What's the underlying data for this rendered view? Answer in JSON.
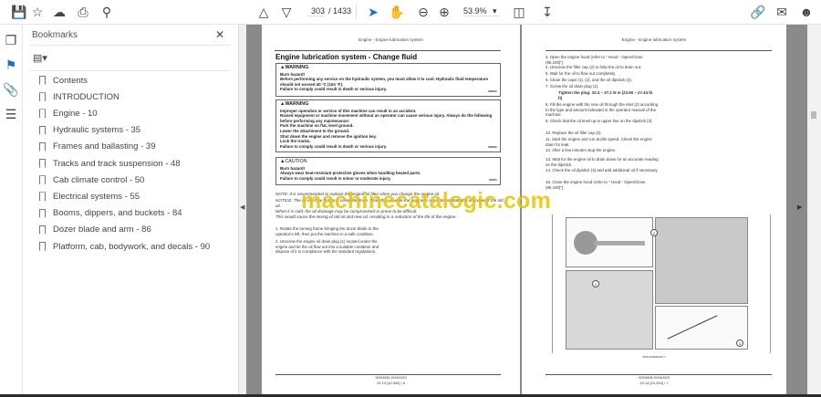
{
  "toolbar": {
    "page_current": "303",
    "page_total": "/ 1433",
    "zoom": "53.9%"
  },
  "bookmarks": {
    "title": "Bookmarks",
    "items": [
      "Contents",
      "INTRODUCTION",
      "Engine - 10",
      "Hydraulic systems - 35",
      "Frames and ballasting - 39",
      "Tracks and track suspension - 48",
      "Cab climate control - 50",
      "Electrical systems - 55",
      "Booms, dippers, and buckets - 84",
      "Dozer blade and arm - 86",
      "Platform, cab, bodywork, and decals - 90"
    ]
  },
  "left_page": {
    "header": "Engine - Engine lubrication system",
    "title": "Engine lubrication system - Change fluid",
    "warning1": {
      "label": "WARNING",
      "lines": [
        "Burn hazard!",
        "Before performing any service on the hydraulic system, you must allow it to cool. Hydraulic fluid temperature should not exceed 40 °C (104 °F).",
        "Failure to comply could result in death or serious injury."
      ],
      "code": "W0001A"
    },
    "warning2": {
      "label": "WARNING",
      "lines": [
        "Improper operation or service of this machine can result in an accident.",
        "Raised equipment or machine movement without an operator can cause serious injury. Always do the following before performing any maintenance:",
        "Park the machine on flat, level ground.",
        "Lower the attachment to the ground.",
        "Shut down the engine and remove the ignition key.",
        "Lock the tracks.",
        "Failure to comply could result in death or serious injury."
      ],
      "code": "W0002A"
    },
    "caution": {
      "label": "CAUTION",
      "lines": [
        "Burn hazard!",
        "Always wear heat-resistant protective gloves when handling heated parts.",
        "Failure to comply could result in minor or moderate injury."
      ],
      "code": "C0007A"
    },
    "notes": [
      "NOTE: It is recommended to replace the engine oil filter when you change the engine oil.",
      "NOTICE: The oil must be hot for a complete drain. Drain the oil while the engine is warm to facilitate the drainage of the old oil.",
      "When it is cold, the oil drainage may be compromised or prove to be difficult.",
      "This would cause the mixing of old oil and new oil, resulting in a reduction of the life of the engine."
    ],
    "steps": [
      "1.  Rotate the turning frame bringing the dozer blade to the operator's left, then put the machine in a safe condition.",
      "2.  Unscrew the engine oil drain plug (1) located under the engine and let the oil flow out into a suitable container and dispose of it in compliance with the standard regulations."
    ],
    "footer1": "92909636 20/09/2023",
    "footer2": "10.14 [10.304] / 6"
  },
  "right_page": {
    "header": "Engine - Engine lubrication system",
    "steps": [
      "3.  Open the engine hood (refer to \" Hood - Open/Close (90.100)\").",
      "4.  Unscrew the filler cap (2) to help the oil to drain out.",
      "5.  Wait for the oil to flow out completely.",
      "6.  Clean the caps (1), (2), and the oil dipstick (3).",
      "7.  Screw the oil drain plug (1).",
      "Tighten the plug: 32.4 – 37.2 N·m (23.90 – 27.44 lb ft)",
      "8.  Fill the engine with the new oil through the inlet (2) according to the type and amount indicated in the operator manual of the machine.",
      "9.  Check that the oil level up to upper line on the dipstick (3).",
      "10.  Replace the oil filler cap (2).",
      "11.  Start the engine and run at idle speed. Check the engine drain for leak.",
      "12.  After a few minutes stop the engine.",
      "13.  Wait for the engine oil to drain down for an accurate reading on the dipstick.",
      "14.  Check the oil dipstick (3) and add additional oil if necessary.",
      "15.  Close the engine hood (refer to \" Hood - Open/Close (90.100)\")."
    ],
    "figure_labels": [
      "1",
      "2",
      "3"
    ],
    "figure_caption": "SMIL23NEF0007   7",
    "footer1": "92909636 20/09/2023",
    "footer2": "10.14 [10.304] / 7"
  },
  "watermark": "machinecatalogic.com"
}
